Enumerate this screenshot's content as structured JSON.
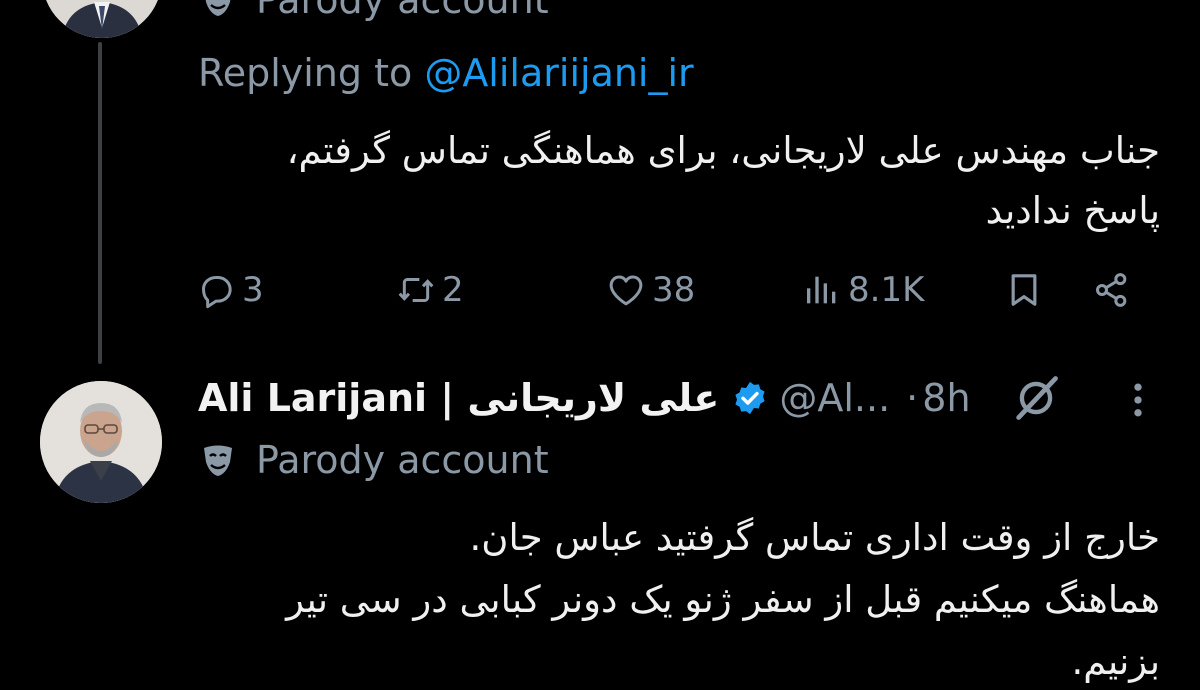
{
  "colors": {
    "background": "#000000",
    "text_primary": "#e7e9ea",
    "text_secondary": "#8b98a5",
    "accent_link": "#1d9bf0",
    "verified_badge": "#1d9bf0",
    "thread_line": "#3e4144"
  },
  "parent_tweet": {
    "parody_label": "Parody account",
    "replying_prefix": "Replying to ",
    "replying_handle": "@Alilariijani_ir",
    "body_lines": [
      "جناب مهندس علی لاریجانی، برای هماهنگی تماس گرفتم،",
      "پاسخ ندادید"
    ],
    "actions": {
      "reply_count": "3",
      "retweet_count": "2",
      "like_count": "38",
      "views_count": "8.1K"
    },
    "icons": [
      "reply-icon",
      "retweet-icon",
      "like-icon",
      "views-icon",
      "bookmark-icon",
      "share-icon"
    ]
  },
  "reply_tweet": {
    "display_name": "Ali Larijani | علی لاریجانی",
    "handle": "@Al...",
    "separator": "·",
    "time": "8h",
    "parody_label": "Parody account",
    "body_lines": [
      "خارج از وقت اداری تماس گرفتید عباس جان.",
      "هماهنگ میکنیم قبل از سفر ژنو یک دونر کبابی در سی تیر",
      "بزنیم."
    ],
    "icons": [
      "verified-badge-icon",
      "grok-icon",
      "more-options-icon",
      "parody-mask-icon"
    ]
  }
}
